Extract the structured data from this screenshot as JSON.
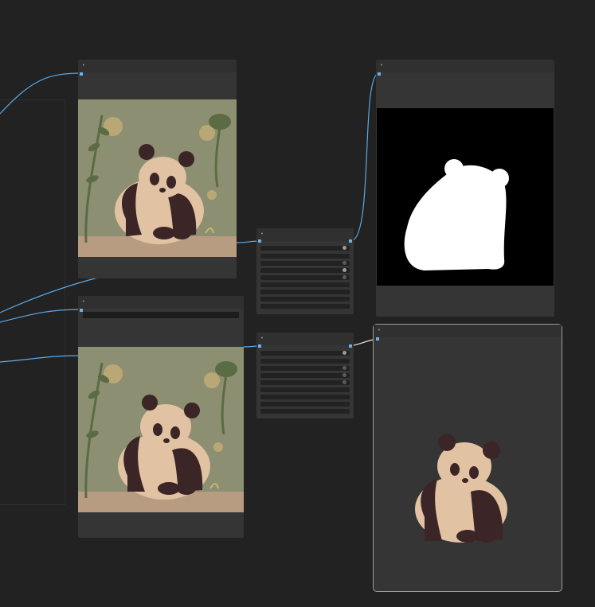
{
  "canvas": {
    "background": "#222222",
    "wire_color": "#5aa8e6",
    "selected_wire_color": "#e8e8e8"
  },
  "nodes": {
    "image_node_top": {
      "icon": "collapse-dot-icon"
    },
    "image_node_bottom": {
      "icon": "collapse-dot-icon"
    },
    "settings_node_top": {
      "icon": "collapse-dot-icon",
      "widget_rows": 10
    },
    "settings_node_bottom": {
      "icon": "collapse-dot-icon",
      "widget_rows": 10
    },
    "mask_preview_node": {
      "icon": "collapse-dot-icon"
    },
    "cutout_preview_node": {
      "icon": "collapse-dot-icon",
      "selected": true
    }
  }
}
